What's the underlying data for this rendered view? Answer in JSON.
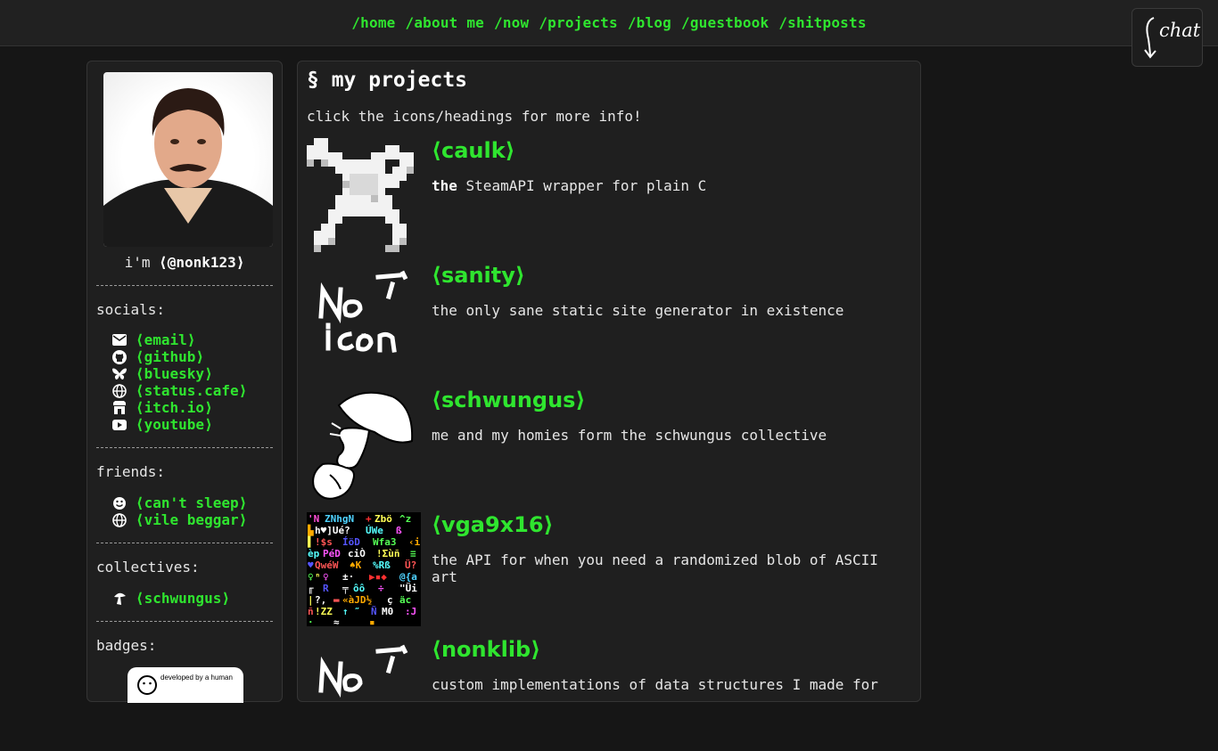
{
  "nav": {
    "items": [
      "/home",
      "/about me",
      "/now",
      "/projects",
      "/blog",
      "/guestbook",
      "/shitposts"
    ]
  },
  "chat": {
    "label": "chat"
  },
  "sidebar": {
    "handle_prefix": "i'm ",
    "handle_name": "⟨@nonk123⟩",
    "socials_title": "socials:",
    "socials": [
      {
        "icon": "envelope-icon",
        "label": "⟨email⟩"
      },
      {
        "icon": "github-icon",
        "label": "⟨github⟩"
      },
      {
        "icon": "butterfly-icon",
        "label": "⟨bluesky⟩"
      },
      {
        "icon": "globe-icon",
        "label": "⟨status.cafe⟩"
      },
      {
        "icon": "store-icon",
        "label": "⟨itch.io⟩"
      },
      {
        "icon": "youtube-icon",
        "label": "⟨youtube⟩"
      }
    ],
    "friends_title": "friends:",
    "friends": [
      {
        "icon": "smiley-icon",
        "label": "⟨can't sleep⟩"
      },
      {
        "icon": "globe-icon",
        "label": "⟨vile beggar⟩"
      }
    ],
    "collectives_title": "collectives:",
    "collectives": [
      {
        "icon": "mushroom-icon",
        "label": "⟨schwungus⟩"
      }
    ],
    "badges_title": "badges:",
    "badge_text": "developed by a human"
  },
  "main": {
    "title": "§ my projects",
    "intro": "click the icons/headings for more info!",
    "projects": [
      {
        "title": "⟨caulk⟩",
        "desc_bold": "the",
        "desc": " SteamAPI wrapper for plain C",
        "icon": "caulk-icon"
      },
      {
        "title": "⟨sanity⟩",
        "desc_bold": "",
        "desc": "the only sane static site generator in existence",
        "icon": "no-icon-placeholder"
      },
      {
        "title": "⟨schwungus⟩",
        "desc_bold": "",
        "desc": "me and my homies form the schwungus collective",
        "icon": "mushroom-icon"
      },
      {
        "title": "⟨vga9x16⟩",
        "desc_bold": "",
        "desc": "the API for when you need a randomized blob of ASCII art",
        "icon": "ascii-art-icon"
      },
      {
        "title": "⟨nonklib⟩",
        "desc_bold": "",
        "desc": "custom implementations of data structures I made for",
        "icon": "no-icon-placeholder"
      }
    ]
  },
  "colors": {
    "background": "#161616",
    "panel": "#1f1f1f",
    "nav": "#212121",
    "link": "#2fe52f",
    "text": "#e6e6e6"
  }
}
